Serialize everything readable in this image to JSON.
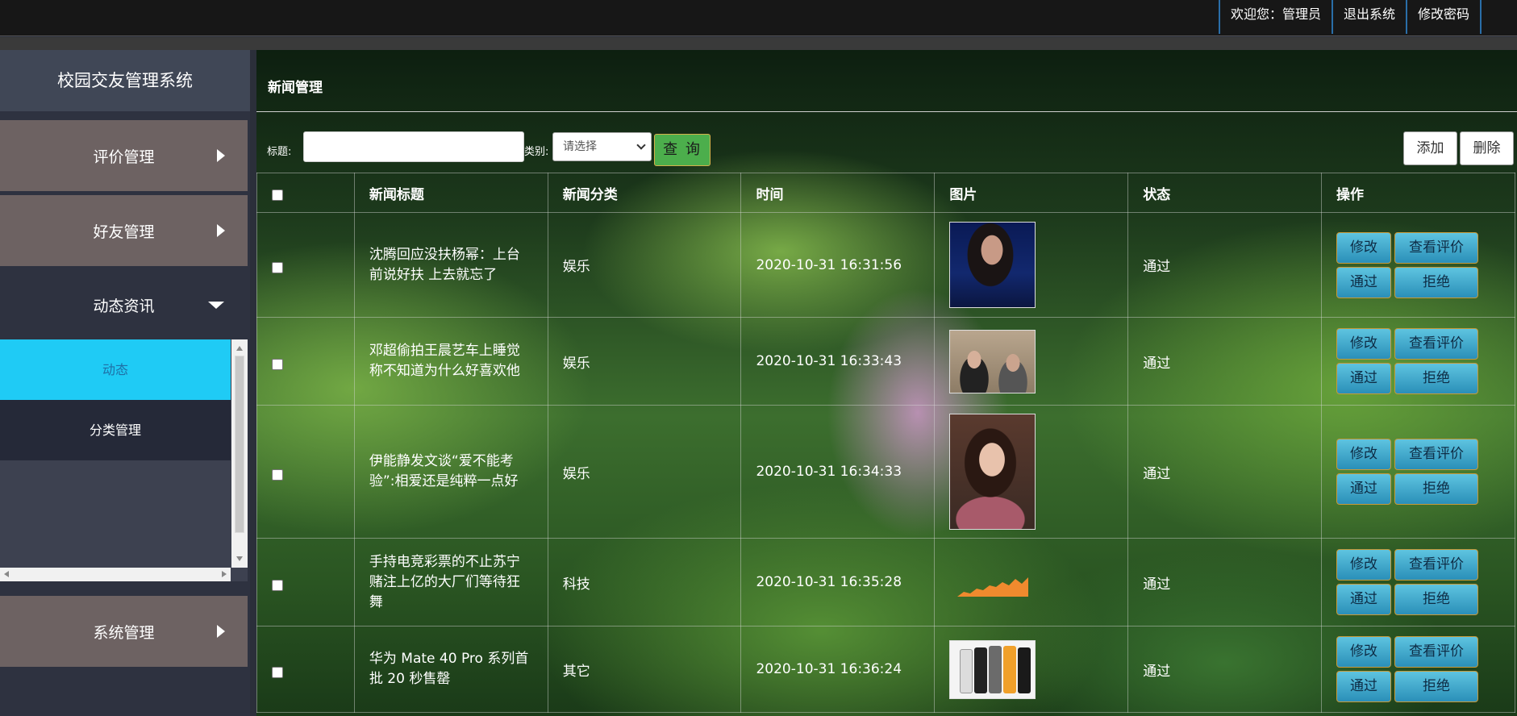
{
  "topbar": {
    "welcome": "欢迎您：管理员",
    "logout": "退出系统",
    "change_password": "修改密码"
  },
  "sidebar": {
    "brand": "校园交友管理系统",
    "menu": [
      {
        "label": "评价管理",
        "icon": "caret-right-icon",
        "state": "collapsed"
      },
      {
        "label": "好友管理",
        "icon": "caret-right-icon",
        "state": "collapsed"
      },
      {
        "label": "动态资讯",
        "icon": "caret-down-icon",
        "state": "expanded"
      },
      {
        "label": "系统管理",
        "icon": "caret-right-icon",
        "state": "collapsed"
      }
    ],
    "submenu": [
      {
        "label": "动态",
        "active": true
      },
      {
        "label": "分类管理",
        "active": false
      }
    ]
  },
  "main": {
    "title": "新闻管理",
    "search": {
      "title_label": "标题:",
      "title_value": "",
      "category_label": "类别:",
      "category_selected": "请选择",
      "query_button": "查 询"
    },
    "add_button": "添加",
    "delete_button": "删除",
    "table": {
      "headers": [
        "",
        "新闻标题",
        "新闻分类",
        "时间",
        "图片",
        "状态",
        "操作"
      ],
      "rows": [
        {
          "title": "沈腾回应没扶杨幂：上台前说好扶 上去就忘了",
          "category": "娱乐",
          "time": "2020-10-31 16:31:56",
          "image": "woman-portrait-photo",
          "status": "通过"
        },
        {
          "title": "邓超偷拍王晨艺车上睡觉称不知道为什么好喜欢他",
          "category": "娱乐",
          "time": "2020-10-31 16:33:43",
          "image": "car-interior-photo",
          "status": "通过"
        },
        {
          "title": "伊能静发文谈“爱不能考验”:相爱还是纯粹一点好",
          "category": "娱乐",
          "time": "2020-10-31 16:34:33",
          "image": "woman-selfie-photo",
          "status": "通过"
        },
        {
          "title": "手持电竞彩票的不止苏宁 赌注上亿的大厂们等待狂舞",
          "category": "科技",
          "time": "2020-10-31 16:35:28",
          "image": "area-chart-image",
          "status": "通过"
        },
        {
          "title": "华为 Mate 40 Pro 系列首批 20 秒售罄",
          "category": "其它",
          "time": "2020-10-31 16:36:24",
          "image": "phones-photo",
          "status": "通过"
        }
      ],
      "row_actions": [
        "修改",
        "查看评价",
        "通过",
        "拒绝"
      ]
    }
  },
  "colors": {
    "active_submenu_bg": "#1fcbf5",
    "menu_item_bg": "#6d6262",
    "query_button_bg": "#4cae4c",
    "action_button_bg": "#3aa0c8"
  }
}
